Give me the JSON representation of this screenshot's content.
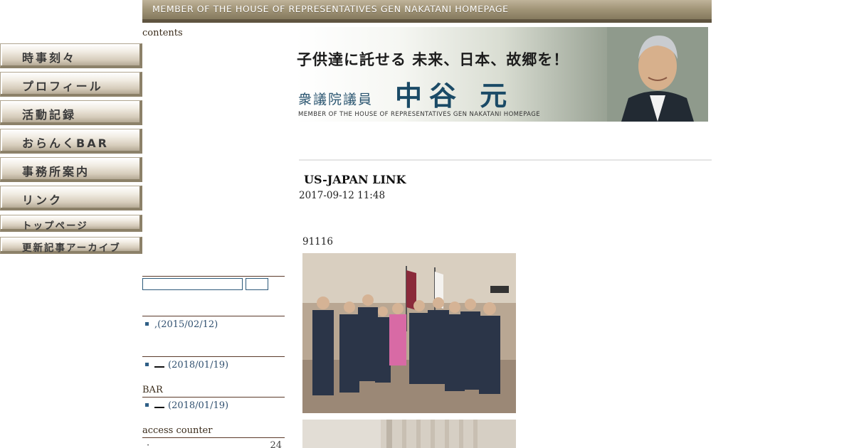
{
  "header": {
    "title": "MEMBER OF THE HOUSE OF REPRESENTATIVES GEN NAKATANI HOMEPAGE"
  },
  "sidebar": {
    "contents_heading": "contents",
    "nav": [
      "時事刻々",
      "プロフィール",
      "活動記録",
      "おらんくBAR",
      "事務所案内",
      "リンク",
      "トップページ",
      "更新記事アーカイブ"
    ],
    "sections": [
      {
        "heading": "",
        "item_prefix": ",",
        "item_date": "(2015/02/12)"
      },
      {
        "heading": "",
        "item_prefix": "",
        "item_date": "(2018/01/19)"
      },
      {
        "heading": "BAR",
        "item_prefix": "",
        "item_date": "(2018/01/19)"
      }
    ],
    "counter": {
      "heading": "access counter",
      "label": "·",
      "value": "24"
    }
  },
  "banner": {
    "slogan": "子供達に託せる 未来、日本、故郷を！",
    "role": "衆議院議員",
    "name": "中谷 元",
    "subtitle": "MEMBER OF THE HOUSE OF REPRESENTATIVES GEN NAKATANI HOMEPAGE"
  },
  "post": {
    "title": "US-JAPAN LINK",
    "date": "2017-09-12 11:48",
    "text": "91116"
  },
  "colors": {
    "header_bar": "#a39679",
    "link": "#2f4f6f",
    "banner_name": "#1a4a66"
  }
}
